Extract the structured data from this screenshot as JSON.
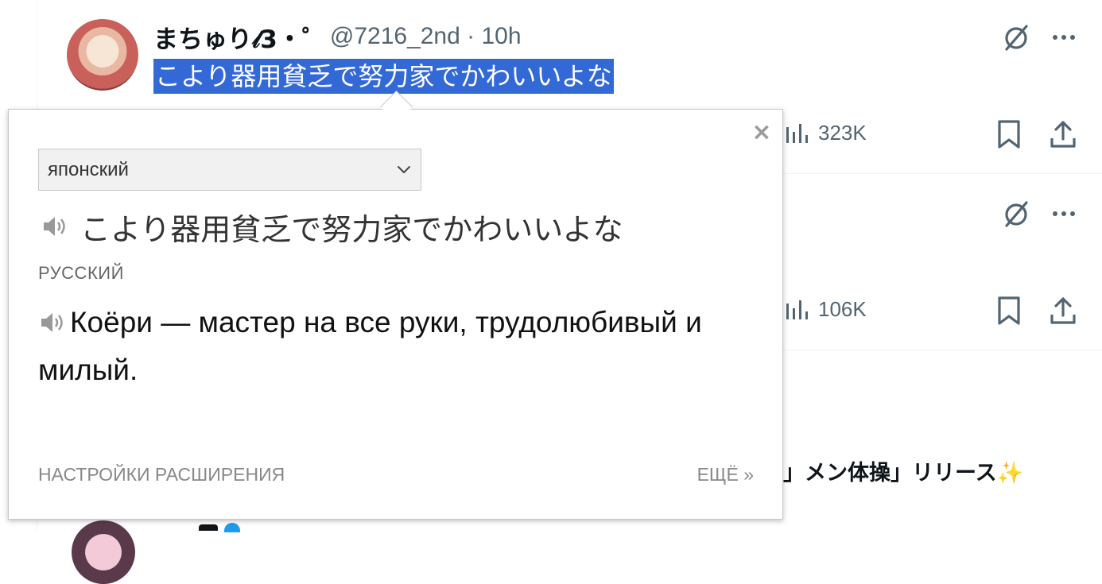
{
  "tweet1": {
    "author_name": "まちゅり𝓁3・゜",
    "author_meta": "@7216_2nd · 10h",
    "text": "こより器用貧乏で努力家でかわいいよな",
    "views": "323K"
  },
  "tweet2": {
    "views": "106K"
  },
  "trend": {
    "text": "」メン体操」リリース✨"
  },
  "popup": {
    "close_label": "×",
    "source_language": "японский",
    "source_text": "こより器用貧乏で努力家でかわいいよな",
    "target_language_label": "РУССКИЙ",
    "translation_text": "Коёри — мастер на все руки, трудолюбивый и милый.",
    "settings_link": "НАСТРОЙКИ РАСШИРЕНИЯ",
    "more_link": "ЕЩЁ »"
  },
  "colors": {
    "selection": "#3369d6",
    "muted": "#536471",
    "accent": "#1d9bf0"
  },
  "icons": [
    "grok-icon",
    "more-icon",
    "views-icon",
    "bookmark-icon",
    "share-icon",
    "speaker-icon",
    "chevron-down-icon",
    "close-icon"
  ]
}
